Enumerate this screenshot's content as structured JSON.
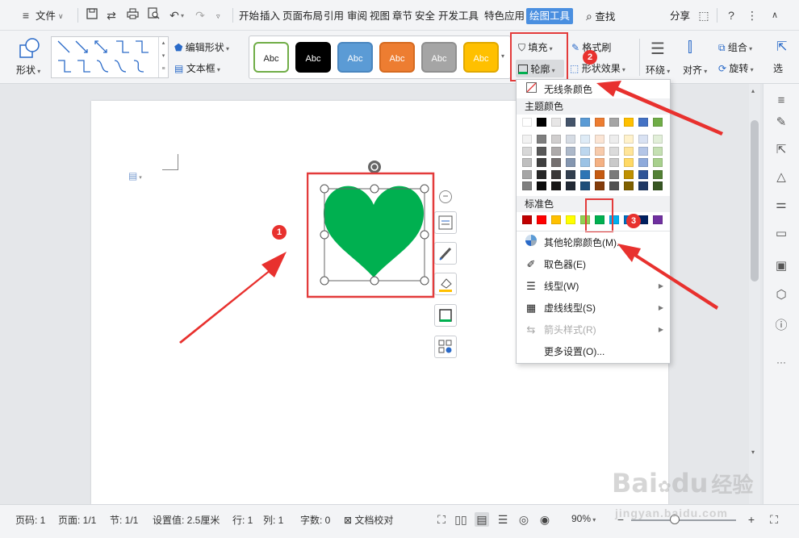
{
  "menubar": {
    "file_label": "文件",
    "tabs": [
      "开始",
      "插入",
      "页面布局",
      "引用",
      "审阅",
      "视图",
      "章节",
      "安全",
      "开发工具",
      "特色应用",
      "绘图工具"
    ],
    "find_label": "查找",
    "share_label": "分享"
  },
  "ribbon": {
    "shape_label": "形状",
    "edit_shape_label": "编辑形状",
    "textbox_label": "文本框",
    "style_buttons": [
      {
        "label": "Abc",
        "bg": "#ffffff",
        "fg": "#222222",
        "border": "#70ad47"
      },
      {
        "label": "Abc",
        "bg": "#000000",
        "fg": "#ffffff",
        "border": "#000000"
      },
      {
        "label": "Abc",
        "bg": "#5b9bd5",
        "fg": "#ffffff",
        "border": "#4a86bf"
      },
      {
        "label": "Abc",
        "bg": "#ed7d31",
        "fg": "#ffffff",
        "border": "#d56a20"
      },
      {
        "label": "Abc",
        "bg": "#a5a5a5",
        "fg": "#ffffff",
        "border": "#8f8f8f"
      },
      {
        "label": "Abc",
        "bg": "#ffc000",
        "fg": "#ffffff",
        "border": "#e0a800"
      }
    ],
    "fill_label": "填充",
    "outline_label": "轮廓",
    "format_painter_label": "格式刷",
    "shape_effects_label": "形状效果",
    "wrap_label": "环绕",
    "align_label": "对齐",
    "group_label": "组合",
    "rotate_label": "旋转",
    "more_label": "选"
  },
  "shape": {
    "color": "#00b050"
  },
  "annotations": {
    "badge1": "1",
    "badge2": "2",
    "badge3": "3",
    "arrow_color": "#e8312e"
  },
  "dropdown": {
    "no_line": "无线条颜色",
    "theme_title": "主题颜色",
    "theme_top": [
      "#ffffff",
      "#000000",
      "#e7e6e6",
      "#44546a",
      "#5b9bd5",
      "#ed7d31",
      "#a5a5a5",
      "#ffc000",
      "#4472c4",
      "#70ad47"
    ],
    "theme_shades": [
      [
        "#f2f2f2",
        "#7f7f7f",
        "#d0cece",
        "#d6dce4",
        "#deebf6",
        "#fbe5d5",
        "#ededed",
        "#fff2cc",
        "#d9e2f3",
        "#e2efd9"
      ],
      [
        "#d8d8d8",
        "#595959",
        "#aeabab",
        "#adb9ca",
        "#bdd7ee",
        "#f7cbac",
        "#dbdbdb",
        "#ffe599",
        "#b4c6e7",
        "#c5e0b3"
      ],
      [
        "#bfbfbf",
        "#3f3f3f",
        "#757070",
        "#8496b0",
        "#9cc3e5",
        "#f4b183",
        "#c9c9c9",
        "#ffd965",
        "#8eaadb",
        "#a8d08d"
      ],
      [
        "#a5a5a5",
        "#262626",
        "#3a3838",
        "#323f4f",
        "#2e75b5",
        "#c55a11",
        "#7b7b7b",
        "#bf9000",
        "#2f5496",
        "#538135"
      ],
      [
        "#7f7f7f",
        "#0c0c0c",
        "#171616",
        "#222a35",
        "#1f4e79",
        "#833c0b",
        "#525252",
        "#7f6000",
        "#1f3864",
        "#375623"
      ]
    ],
    "standard_title": "标准色",
    "standard": [
      "#c00000",
      "#ff0000",
      "#ffc000",
      "#ffff00",
      "#92d050",
      "#00b050",
      "#00b0f0",
      "#0070c0",
      "#002060",
      "#7030a0"
    ],
    "more_colors": "其他轮廓颜色(M)...",
    "eyedropper": "取色器(E)",
    "line_type": "线型(W)",
    "dash_type": "虚线线型(S)",
    "arrow_style": "箭头样式(R)",
    "more_settings": "更多设置(O)..."
  },
  "status": {
    "page_no": "页码: 1",
    "page": "页面: 1/1",
    "section": "节: 1/1",
    "setting": "设置值: 2.5厘米",
    "row": "行: 1",
    "col": "列: 1",
    "words": "字数: 0",
    "proof": "文档校对",
    "zoom": "90%"
  },
  "watermark": {
    "text1": "Bai",
    "text2": "du",
    "text3": "经验",
    "sub": "jingyan.baidu.com"
  }
}
